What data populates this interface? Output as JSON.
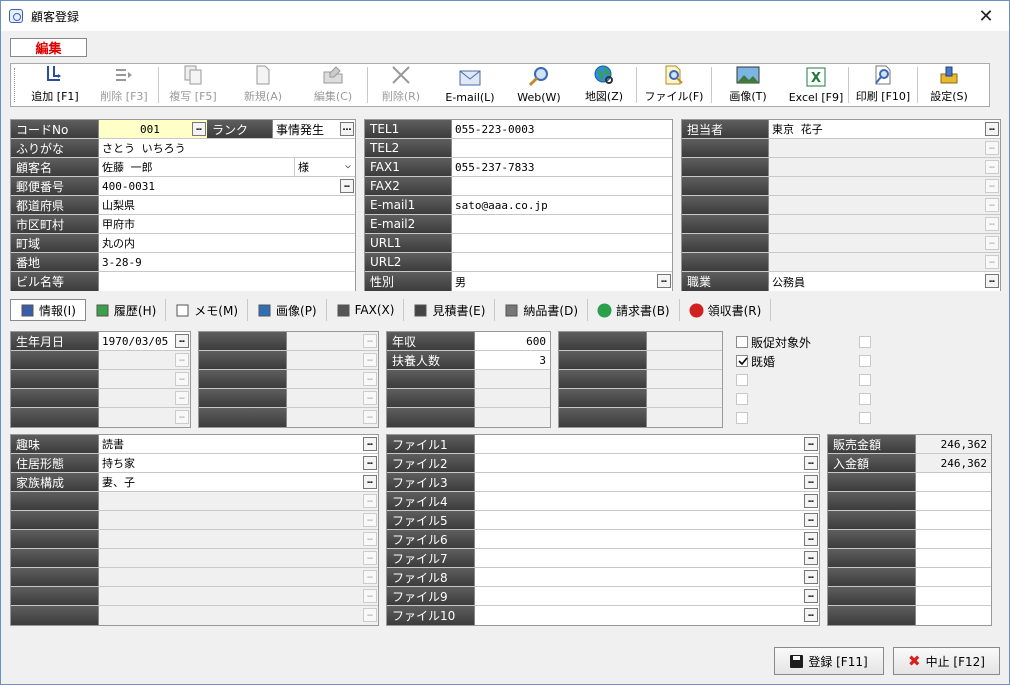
{
  "window": {
    "title": "顧客登録",
    "close": "✕"
  },
  "mode_label": "編集",
  "toolbar": [
    {
      "label": "追加 [F1]",
      "icon": "add-icon",
      "enabled": true
    },
    {
      "label": "削除 [F3]",
      "icon": "delete-row-icon",
      "enabled": false
    },
    {
      "label": "複写 [F5]",
      "icon": "copy-icon",
      "enabled": false
    },
    {
      "label": "新規(A)",
      "icon": "new-document-icon",
      "enabled": false
    },
    {
      "label": "編集(C)",
      "icon": "edit-folder-icon",
      "enabled": false
    },
    {
      "label": "削除(R)",
      "icon": "delete-x-icon",
      "enabled": false
    },
    {
      "label": "E-mail(L)",
      "icon": "mail-icon",
      "enabled": true
    },
    {
      "label": "Web(W)",
      "icon": "web-search-icon",
      "enabled": true
    },
    {
      "label": "地図(Z)",
      "icon": "globe-icon",
      "enabled": true
    },
    {
      "label": "ファイル(F)",
      "icon": "file-search-icon",
      "enabled": true
    },
    {
      "label": "画像(T)",
      "icon": "image-icon",
      "enabled": true
    },
    {
      "label": "Excel [F9]",
      "icon": "excel-icon",
      "enabled": true
    },
    {
      "label": "印刷 [F10]",
      "icon": "print-preview-icon",
      "enabled": true
    },
    {
      "label": "設定(S)",
      "icon": "settings-icon",
      "enabled": true
    }
  ],
  "customer": {
    "code_label": "コードNo",
    "code": "001",
    "rank_label": "ランク",
    "rank": "事情発生",
    "furigana_label": "ふりがな",
    "furigana": "さとう いちろう",
    "name_label": "顧客名",
    "name": "佐藤 一郎",
    "honorific": "様",
    "zip_label": "郵便番号",
    "zip": "400-0031",
    "pref_label": "都道府県",
    "pref": "山梨県",
    "city_label": "市区町村",
    "city": "甲府市",
    "town_label": "町域",
    "town": "丸の内",
    "banchi_label": "番地",
    "banchi": "3-28-9",
    "building_label": "ビル名等",
    "building": ""
  },
  "contact": {
    "tel1_label": "TEL1",
    "tel1": "055-223-0003",
    "tel2_label": "TEL2",
    "tel2": "",
    "fax1_label": "FAX1",
    "fax1": "055-237-7833",
    "fax2_label": "FAX2",
    "fax2": "",
    "email1_label": "E-mail1",
    "email1": "sato@aaa.co.jp",
    "email2_label": "E-mail2",
    "email2": "",
    "url1_label": "URL1",
    "url1": "",
    "url2_label": "URL2",
    "url2": "",
    "gender_label": "性別",
    "gender": "男"
  },
  "staff": {
    "tantou_label": "担当者",
    "tantou": "東京 花子",
    "job_label": "職業",
    "job": "公務員"
  },
  "tabs": [
    {
      "label": "情報(I)",
      "icon": "info-book-icon",
      "active": true
    },
    {
      "label": "履歴(H)",
      "icon": "history-icon",
      "active": false
    },
    {
      "label": "メモ(M)",
      "icon": "memo-icon",
      "active": false
    },
    {
      "label": "画像(P)",
      "icon": "picture-icon",
      "active": false
    },
    {
      "label": "FAX(X)",
      "icon": "fax-icon",
      "active": false
    },
    {
      "label": "見積書(E)",
      "icon": "estimate-icon",
      "active": false
    },
    {
      "label": "納品書(D)",
      "icon": "delivery-icon",
      "active": false
    },
    {
      "label": "請求書(B)",
      "icon": "invoice-icon",
      "active": false
    },
    {
      "label": "領収書(R)",
      "icon": "receipt-icon",
      "active": false
    }
  ],
  "info": {
    "birth_label": "生年月日",
    "birth": "1970/03/05",
    "income_label": "年収",
    "income": "600",
    "dependents_label": "扶養人数",
    "dependents": "3",
    "check1_label": "販促対象外",
    "check1": false,
    "check2_label": "既婚",
    "check2": true,
    "hobby_label": "趣味",
    "hobby": "読書",
    "housing_label": "住居形態",
    "housing": "持ち家",
    "family_label": "家族構成",
    "family": "妻、子",
    "files": [
      "ファイル1",
      "ファイル2",
      "ファイル3",
      "ファイル4",
      "ファイル5",
      "ファイル6",
      "ファイル7",
      "ファイル8",
      "ファイル9",
      "ファイル10"
    ],
    "sales_label": "販売金額",
    "sales": "246,362",
    "paid_label": "入金額",
    "paid": "246,362"
  },
  "buttons": {
    "save": "登録 [F11]",
    "cancel": "中止 [F12]"
  },
  "ellipsis": "…",
  "colors": {
    "label_bg": "#4a4a4a",
    "mode_text": "#e00000",
    "highlight": "#ffffc8"
  }
}
